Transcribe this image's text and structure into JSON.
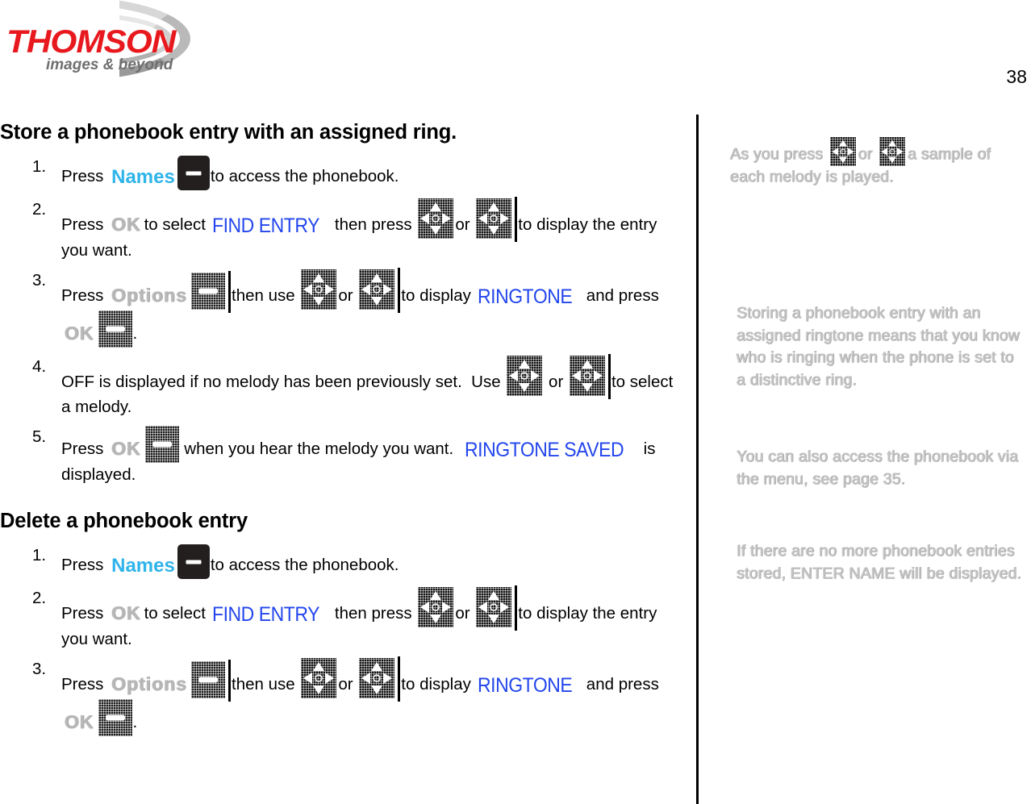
{
  "header": {
    "logo_wordmark": "THOMSON",
    "logo_tagline": "images & beyond",
    "page_number": "38"
  },
  "colors": {
    "brand_red": "#e8191e",
    "softkey_label_blue": "#2fb4ea",
    "lcd_text_blue": "#2346ec",
    "faint_gray": "#b7b7b7"
  },
  "sections": [
    {
      "heading": "Store a phonebook entry with an assigned ring.",
      "steps": [
        {
          "number": "1.",
          "parts": [
            {
              "type": "text",
              "value": "Press "
            },
            {
              "type": "softlabel",
              "value": "Names"
            },
            {
              "type": "key",
              "value": "soft-key-dash-icon"
            },
            {
              "type": "text",
              "value": "to access the phonebook."
            }
          ]
        },
        {
          "number": "2.",
          "parts": [
            {
              "type": "text",
              "value": "Press "
            },
            {
              "type": "lcd-faint",
              "value": "OK"
            },
            {
              "type": "text",
              "value": "to select "
            },
            {
              "type": "lcd-blue",
              "value": "FIND ENTRY"
            },
            {
              "type": "text",
              "value": " then press "
            },
            {
              "type": "key",
              "value": "nav-key-4way-icon"
            },
            {
              "type": "text",
              "value": "or "
            },
            {
              "type": "key",
              "value": "nav-key-4way-bar-icon"
            },
            {
              "type": "text",
              "value": "to display the entry you want."
            }
          ]
        },
        {
          "number": "3.",
          "parts": [
            {
              "type": "text",
              "value": "Press "
            },
            {
              "type": "lcd-faint",
              "value": "Options"
            },
            {
              "type": "key",
              "value": "dither-key-bar-icon"
            },
            {
              "type": "text",
              "value": "then use "
            },
            {
              "type": "key",
              "value": "nav-key-4way-icon"
            },
            {
              "type": "text",
              "value": "or "
            },
            {
              "type": "key",
              "value": "nav-key-4way-bar-icon"
            },
            {
              "type": "text",
              "value": "to display "
            },
            {
              "type": "lcd-blue",
              "value": "RINGTONE"
            },
            {
              "type": "text",
              "value": " and press "
            },
            {
              "type": "lcd-faint",
              "value": "OK"
            },
            {
              "type": "key",
              "value": "dither-key-icon"
            },
            {
              "type": "text",
              "value": "."
            }
          ]
        },
        {
          "number": "4.",
          "parts": [
            {
              "type": "text",
              "value": "OFF is displayed if no melody has been previously set.  Use "
            },
            {
              "type": "key",
              "value": "nav-key-4way-icon"
            },
            {
              "type": "text",
              "value": " or "
            },
            {
              "type": "key",
              "value": "nav-key-4way-bar-icon"
            },
            {
              "type": "text",
              "value": "to select a melody."
            }
          ]
        },
        {
          "number": "5.",
          "parts": [
            {
              "type": "text",
              "value": "Press "
            },
            {
              "type": "lcd-faint",
              "value": "OK"
            },
            {
              "type": "key",
              "value": "dither-key-icon"
            },
            {
              "type": "text",
              "value": " when you hear the melody you want.  "
            },
            {
              "type": "lcd-blue",
              "value": "RINGTONE SAVED"
            },
            {
              "type": "text",
              "value": " is displayed."
            }
          ]
        }
      ]
    },
    {
      "heading": "Delete a phonebook entry",
      "steps": [
        {
          "number": "1.",
          "parts": [
            {
              "type": "text",
              "value": "Press "
            },
            {
              "type": "softlabel",
              "value": "Names"
            },
            {
              "type": "key",
              "value": "soft-key-dash-icon"
            },
            {
              "type": "text",
              "value": "to access the phonebook."
            }
          ]
        },
        {
          "number": "2.",
          "parts": [
            {
              "type": "text",
              "value": "Press "
            },
            {
              "type": "lcd-faint",
              "value": "OK"
            },
            {
              "type": "text",
              "value": "to select "
            },
            {
              "type": "lcd-blue",
              "value": "FIND ENTRY"
            },
            {
              "type": "text",
              "value": " then press "
            },
            {
              "type": "key",
              "value": "nav-key-4way-icon"
            },
            {
              "type": "text",
              "value": "or "
            },
            {
              "type": "key",
              "value": "nav-key-4way-bar-icon"
            },
            {
              "type": "text",
              "value": "to display the entry you want."
            }
          ]
        },
        {
          "number": "3.",
          "parts": [
            {
              "type": "text",
              "value": "Press "
            },
            {
              "type": "lcd-faint",
              "value": "Options"
            },
            {
              "type": "key",
              "value": "dither-key-bar-icon"
            },
            {
              "type": "text",
              "value": "then use "
            },
            {
              "type": "key",
              "value": "nav-key-4way-icon"
            },
            {
              "type": "text",
              "value": "or "
            },
            {
              "type": "key",
              "value": "nav-key-4way-bar-icon"
            },
            {
              "type": "text",
              "value": "to display "
            },
            {
              "type": "lcd-blue",
              "value": "RINGTONE"
            },
            {
              "type": "text",
              "value": " and press "
            },
            {
              "type": "lcd-faint",
              "value": "OK"
            },
            {
              "type": "key",
              "value": "dither-key-icon"
            },
            {
              "type": "text",
              "value": "."
            }
          ]
        }
      ]
    }
  ],
  "sidebar_notes": [
    {
      "id": "note-sample-melody",
      "parts": [
        {
          "type": "text",
          "value": "As you press "
        },
        {
          "type": "key",
          "value": "nav-key-4way-icon"
        },
        {
          "type": "text",
          "value": "or "
        },
        {
          "type": "key",
          "value": "nav-key-4way-icon"
        },
        {
          "type": "text",
          "value": "a sample of each melody is played."
        }
      ]
    },
    {
      "id": "note-assigned-ringtone",
      "parts": [
        {
          "type": "text",
          "value": "Storing a phonebook entry with an assigned ringtone means that you know who is ringing when the phone is set to a distinctive ring."
        }
      ]
    },
    {
      "id": "note-menu-access",
      "parts": [
        {
          "type": "text",
          "value": "You can also access the phonebook via the menu, see page 35."
        }
      ]
    },
    {
      "id": "note-enter-name",
      "parts": [
        {
          "type": "text",
          "value": "If there are no more phonebook entries stored, ENTER NAME will be displayed."
        }
      ]
    }
  ]
}
